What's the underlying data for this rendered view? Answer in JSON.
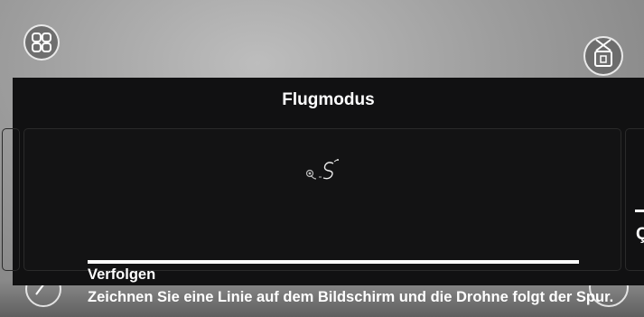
{
  "dialog": {
    "title": "Flugmodus"
  },
  "mode_card": {
    "name": "Verfolgen",
    "description": "Zeichnen Sie eine Linie auf dem Bildschirm und die Drohne folgt der Spur.",
    "icon": "draw-path-icon"
  },
  "next_card": {
    "partial_text": "Ç"
  },
  "icons": {
    "menu": "grid-menu-icon",
    "media": "media-gallery-icon",
    "bottom_left": "compass-icon",
    "bottom_right": "circle-button-icon"
  }
}
